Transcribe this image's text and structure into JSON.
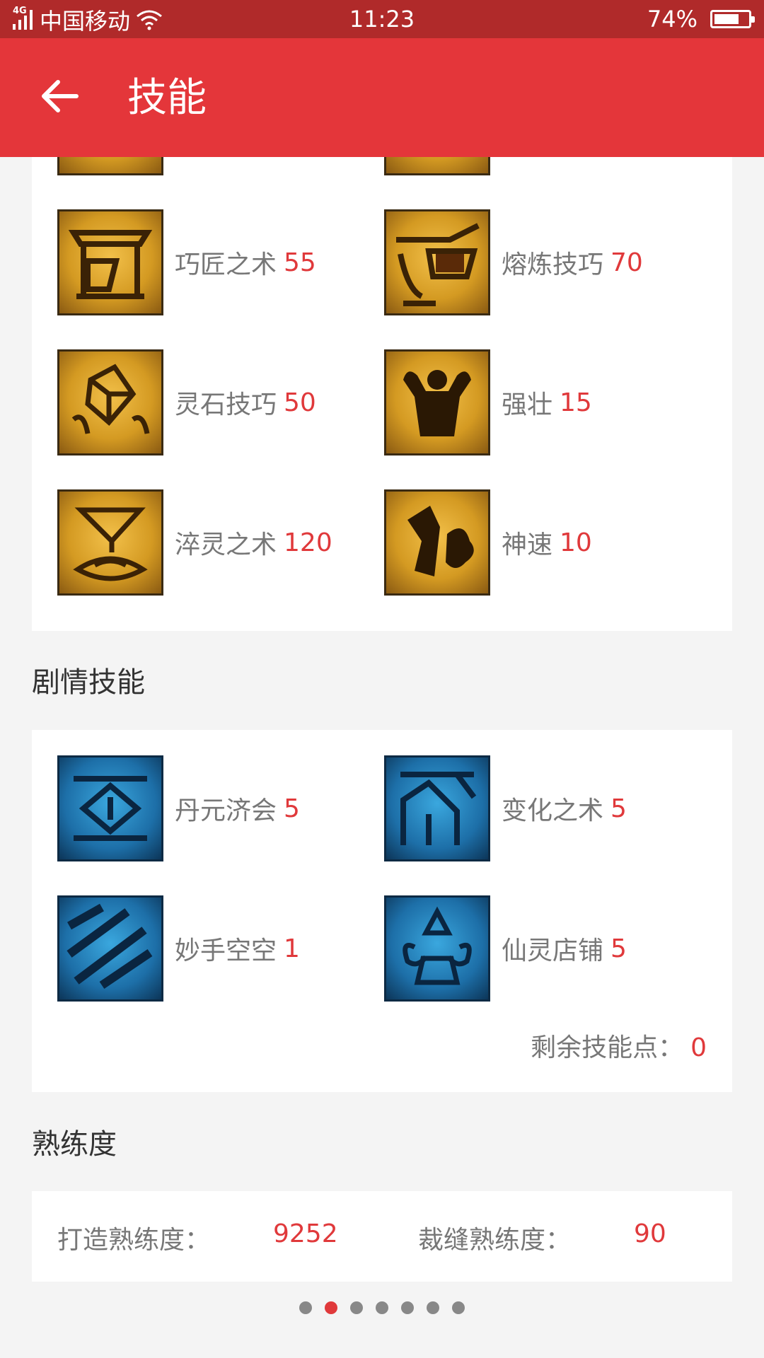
{
  "status": {
    "network": "4G",
    "carrier": "中国移动",
    "time": "11:23",
    "battery_percent": "74%",
    "battery_level": 0.74
  },
  "appbar": {
    "title": "技能"
  },
  "life_skills": [
    {
      "name": "巧匠之术",
      "value": "55",
      "icon": "carpentry-icon"
    },
    {
      "name": "熔炼技巧",
      "value": "70",
      "icon": "smelting-icon"
    },
    {
      "name": "灵石技巧",
      "value": "50",
      "icon": "spirit-stone-icon"
    },
    {
      "name": "强壮",
      "value": "15",
      "icon": "strength-icon"
    },
    {
      "name": "淬灵之术",
      "value": "120",
      "icon": "tempering-icon"
    },
    {
      "name": "神速",
      "value": "10",
      "icon": "swiftness-icon"
    }
  ],
  "story_section_title": "剧情技能",
  "story_skills": [
    {
      "name": "丹元济会",
      "value": "5",
      "icon": "danyuan-icon"
    },
    {
      "name": "变化之术",
      "value": "5",
      "icon": "transform-icon"
    },
    {
      "name": "妙手空空",
      "value": "1",
      "icon": "steal-icon"
    },
    {
      "name": "仙灵店铺",
      "value": "5",
      "icon": "shop-icon"
    }
  ],
  "remaining_points": {
    "label": "剩余技能点：",
    "value": "0"
  },
  "proficiency": {
    "title": "熟练度",
    "forging_label": "打造熟练度：",
    "forging_value": "9252",
    "tailoring_label": "裁缝熟练度：",
    "tailoring_value": "90"
  },
  "pager": {
    "count": 7,
    "active_index": 1
  },
  "colors": {
    "appbar": "#e4363a",
    "statusbar": "#b02a2a",
    "accent": "#e0393b"
  }
}
